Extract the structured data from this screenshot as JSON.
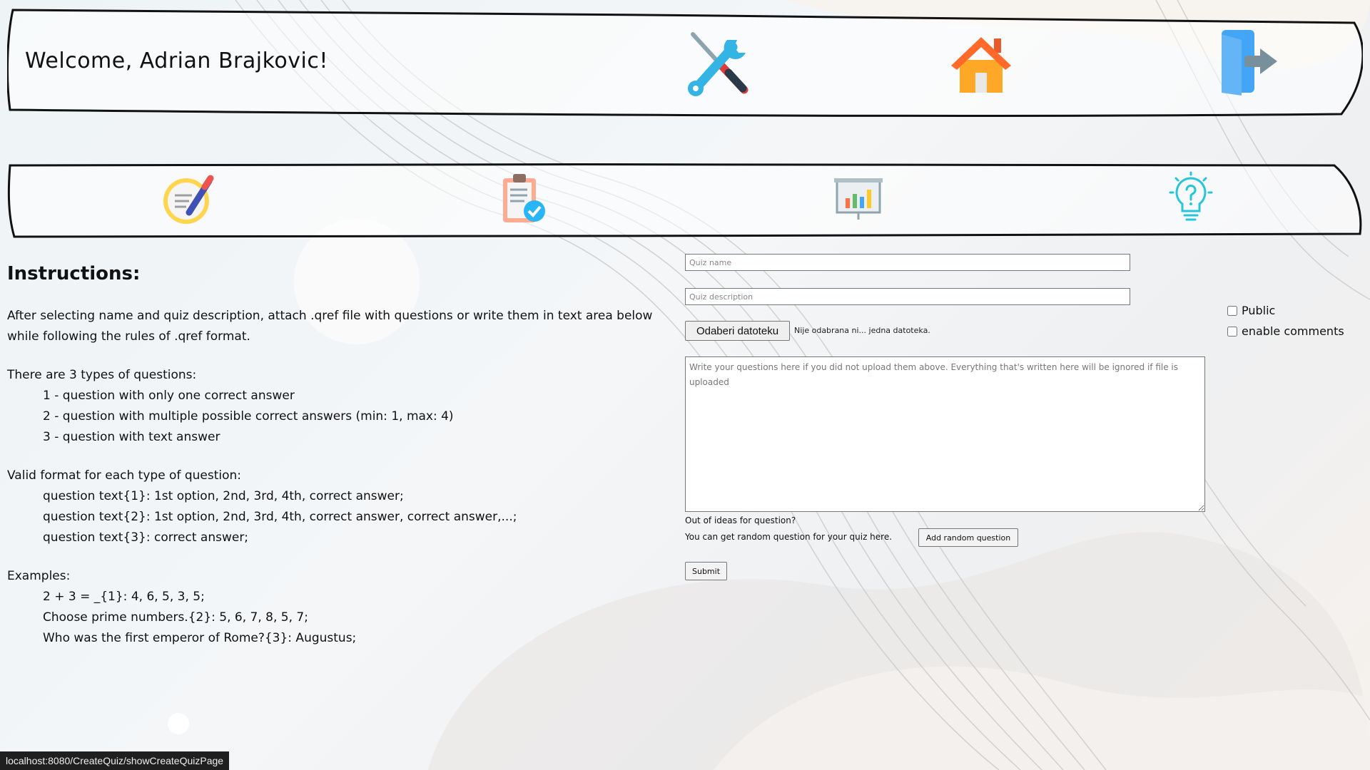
{
  "header": {
    "welcome": "Welcome, Adrian Brajkovic!",
    "icons": [
      "tools-icon",
      "home-icon",
      "logout-icon"
    ]
  },
  "nav": {
    "icons": [
      "create-quiz-icon",
      "quiz-checklist-icon",
      "statistics-icon",
      "idea-lightbulb-icon"
    ]
  },
  "instructions": {
    "title": "Instructions:",
    "intro": "After selecting name and quiz description, attach .qref file with questions or write them in text area below while following the rules of .qref format.",
    "types_heading": "There are 3 types of questions:",
    "types": [
      "1 - question with only one correct answer",
      "2 - question with multiple possible correct answers (min: 1, max: 4)",
      "3 - question with text answer"
    ],
    "format_heading": "Valid format for each type of question:",
    "formats": [
      "question text{1}: 1st option, 2nd, 3rd, 4th, correct answer;",
      "question text{2}: 1st option, 2nd, 3rd, 4th, correct answer, correct answer,...;",
      "question text{3}: correct answer;"
    ],
    "examples_heading": "Examples:",
    "examples": [
      "2 + 3 = _{1}: 4, 6, 5, 3, 5;",
      "Choose prime numbers.{2}: 5, 6, 7, 8, 5, 7;",
      "Who was the first emperor of Rome?{3}: Augustus;"
    ]
  },
  "form": {
    "quiz_name_placeholder": "Quiz name",
    "quiz_description_placeholder": "Quiz description",
    "file_button": "Odaberi datoteku",
    "file_status": "Nije odabrana ni... jedna datoteka.",
    "questions_placeholder": "Write your questions here if you did not upload them above. Everything that's written here will be ignored if file is uploaded",
    "ideas_line1": "Out of ideas for question?",
    "ideas_line2": "You can get random question for your quiz here.",
    "random_button": "Add random question",
    "submit_button": "Submit",
    "public_label": "Public",
    "comments_label": "enable comments"
  },
  "status_bar": "localhost:8080/CreateQuiz/showCreateQuizPage"
}
